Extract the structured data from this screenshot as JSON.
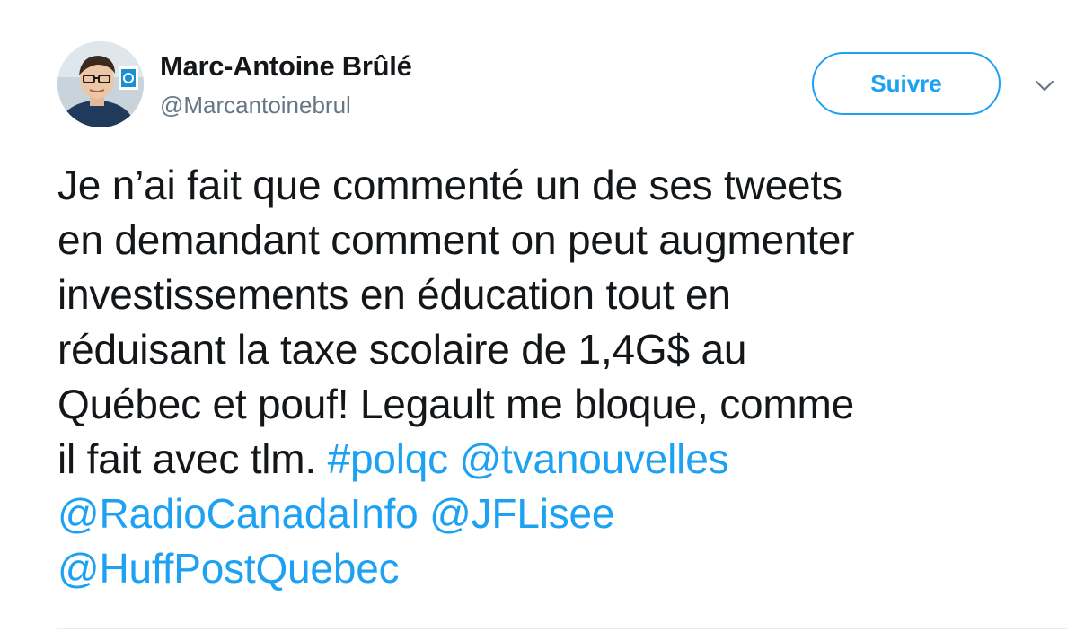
{
  "user": {
    "name": "Marc-Antoine Brûlé",
    "handle": "@Marcantoinebrul",
    "avatar_icon": "profile-photo"
  },
  "follow_button": {
    "label": "Suivre"
  },
  "menu": {
    "icon": "chevron-down-icon"
  },
  "tweet": {
    "lines": [
      {
        "text": "Je n’ai fait que commenté un de ses tweets"
      },
      {
        "text": "en demandant comment on peut augmenter"
      },
      {
        "text": "investissements en éducation tout en"
      },
      {
        "text": "réduisant la taxe scolaire de 1,4G$ au"
      },
      {
        "text": "Québec et pouf! Legault me bloque, comme"
      },
      {
        "text": "il fait avec tlm.",
        "hashtag": "#polqc",
        "mention": "@tvanouvelles"
      },
      {
        "mention1": "@RadioCanadaInfo",
        "mention2": "@JFLisee"
      },
      {
        "mention": "@HuffPostQuebec"
      }
    ]
  },
  "colors": {
    "accent": "#1da1f2",
    "text": "#14171a",
    "secondary": "#657786"
  }
}
